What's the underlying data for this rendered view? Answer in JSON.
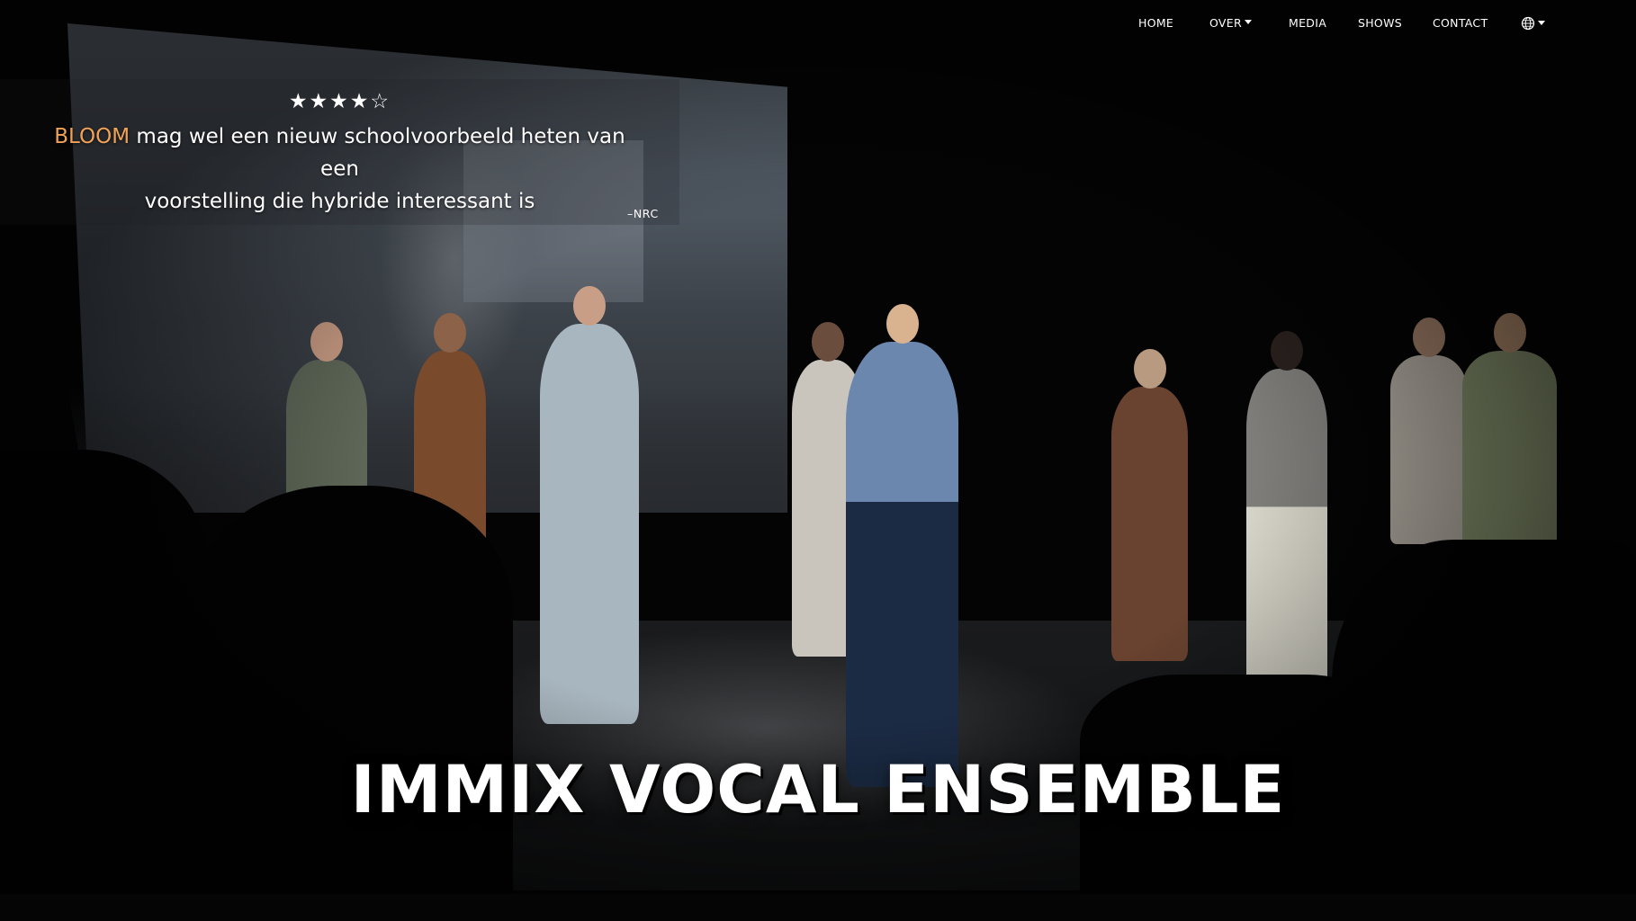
{
  "nav": {
    "items": [
      {
        "label": "HOME"
      },
      {
        "label": "OVER"
      },
      {
        "label": "MEDIA"
      },
      {
        "label": "SHOWS"
      },
      {
        "label": "CONTACT"
      }
    ]
  },
  "review": {
    "rating": 4,
    "max_rating": 5,
    "stars": "★★★★☆",
    "quote_brand": "BLOOM",
    "quote_line1": " mag wel een nieuw schoolvoorbeeld heten van een",
    "quote_line2": "voorstelling die hybride interessant is",
    "source": "–NRC"
  },
  "hero": {
    "title": "IMMIX VOCAL ENSEMBLE"
  },
  "colors": {
    "accent": "#f0a358",
    "text": "#ffffff",
    "background": "#000000"
  },
  "icons": {
    "language": "globe-icon"
  }
}
